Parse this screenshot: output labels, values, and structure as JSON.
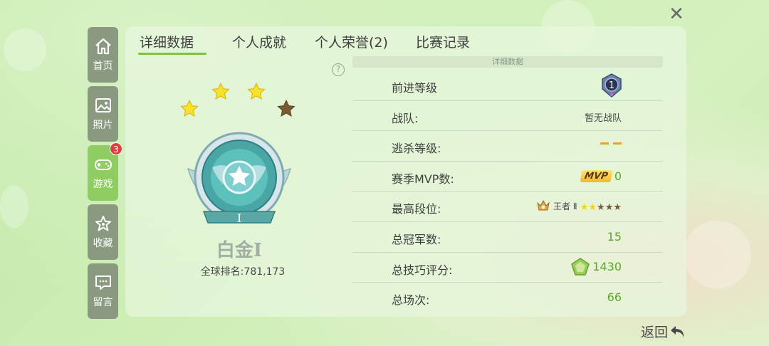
{
  "sidebar": {
    "items": [
      {
        "label": "首页",
        "icon": "home-icon"
      },
      {
        "label": "照片",
        "icon": "photo-icon"
      },
      {
        "label": "游戏",
        "icon": "gamepad-icon",
        "badge": "3"
      },
      {
        "label": "收藏",
        "icon": "star-icon"
      },
      {
        "label": "留言",
        "icon": "message-icon"
      }
    ]
  },
  "tabs": [
    {
      "label": "详细数据"
    },
    {
      "label": "个人成就"
    },
    {
      "label": "个人荣誉(2)"
    },
    {
      "label": "比赛记录"
    }
  ],
  "profile": {
    "rank_name": "白金Ⅰ",
    "medal_numeral": "Ⅰ",
    "global_rank_label": "全球排名:",
    "global_rank_value": "781,173",
    "stars_filled": 3,
    "stars_total": 4
  },
  "stats": {
    "title": "详细数据",
    "rows": [
      {
        "label": "前进等级",
        "value": "1"
      },
      {
        "label": "战队:",
        "value": "暂无战队"
      },
      {
        "label": "逃杀等级:",
        "value": "— —"
      },
      {
        "label": "赛季MVP数:",
        "tag": "MVP",
        "value": "0"
      },
      {
        "label": "最高段位:",
        "value": "王者 Ⅱ",
        "stars_filled": 2,
        "stars_total": 5
      },
      {
        "label": "总冠军数:",
        "value": "15"
      },
      {
        "label": "总技巧评分:",
        "value": "1430"
      },
      {
        "label": "总场次:",
        "value": "66"
      }
    ]
  },
  "footer": {
    "back_label": "返回"
  },
  "colors": {
    "accent": "#7cc24a",
    "value_green": "#5aa82a",
    "active_tab": "#8fcc62"
  }
}
